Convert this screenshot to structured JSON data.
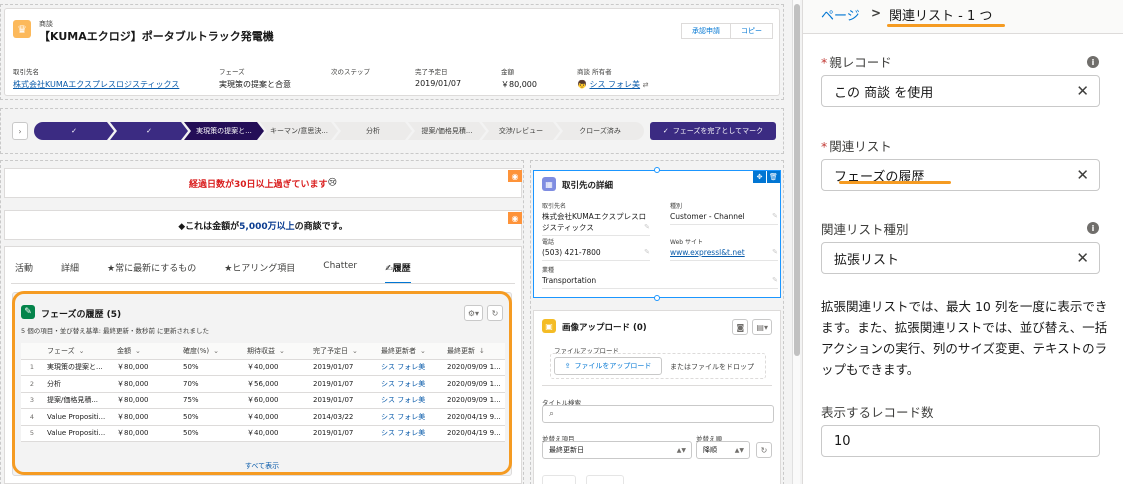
{
  "header": {
    "object_label": "商談",
    "title": "【KUMAエクロジ】ポータブルトラック発電機",
    "buttons": [
      "承認申請",
      "コピー"
    ],
    "fields": [
      {
        "label": "取引先名",
        "value": "株式会社KUMAエクスプレスロジスティックス",
        "link": true
      },
      {
        "label": "フェーズ",
        "value": "実現策の提案と合意",
        "link": false
      },
      {
        "label": "次のステップ",
        "value": "",
        "link": false
      },
      {
        "label": "完了予定日",
        "value": "2019/01/07",
        "link": false
      },
      {
        "label": "金額",
        "value": "￥80,000",
        "link": false
      },
      {
        "label": "商談 所有者",
        "value": "シス フォレ美",
        "link": true
      }
    ]
  },
  "path": {
    "stages": [
      {
        "label": "✓",
        "status": "done"
      },
      {
        "label": "✓",
        "status": "done"
      },
      {
        "label": "実現策の提案と...",
        "status": "current"
      },
      {
        "label": "キーマン/意思決...",
        "status": "todo"
      },
      {
        "label": "分析",
        "status": "todo"
      },
      {
        "label": "提案/価格見積...",
        "status": "todo"
      },
      {
        "label": "交渉/レビュー",
        "status": "todo"
      },
      {
        "label": "クローズ済み",
        "status": "todo"
      }
    ],
    "mark_button": "フェーズを完了としてマーク"
  },
  "banners": {
    "b1_text": "経過日数が30日以上過ぎています",
    "b1_emoji": "😢",
    "b2_prefix": "◆これは金額が",
    "b2_amount": "5,000万以上",
    "b2_suffix": "の商談です。"
  },
  "tabs": [
    "活動",
    "詳細",
    "★常に最新にするもの",
    "★ヒアリング項目",
    "Chatter",
    "✍履歴"
  ],
  "related_list": {
    "title": "フェーズの履歴 (5)",
    "subtitle": "5 個の項目・並び替え基準: 最終更新・数秒前 に更新されました",
    "columns": [
      "",
      "フェーズ",
      "金額",
      "確度(%)",
      "期待収益",
      "完了予定日",
      "最終更新者",
      "最終更新"
    ],
    "rows": [
      [
        "1",
        "実現策の提案と...",
        "￥80,000",
        "50%",
        "￥40,000",
        "2019/01/07",
        "シス フォレ美",
        "2020/09/09 1..."
      ],
      [
        "2",
        "分析",
        "￥80,000",
        "70%",
        "￥56,000",
        "2019/01/07",
        "シス フォレ美",
        "2020/09/09 1..."
      ],
      [
        "3",
        "提案/価格見積...",
        "￥80,000",
        "75%",
        "￥60,000",
        "2019/01/07",
        "シス フォレ美",
        "2020/09/09 1..."
      ],
      [
        "4",
        "Value Propositi...",
        "￥80,000",
        "50%",
        "￥40,000",
        "2014/03/22",
        "シス フォレ美",
        "2020/04/19 9..."
      ],
      [
        "5",
        "Value Propositi...",
        "￥80,000",
        "50%",
        "￥40,000",
        "2019/01/07",
        "シス フォレ美",
        "2020/04/19 9..."
      ]
    ],
    "view_all": "すべて表示"
  },
  "account": {
    "title": "取引先の詳細",
    "name_label": "取引先名",
    "name_value": "株式会社KUMAエクスプレスロジスティックス",
    "type_label": "種別",
    "type_value": "Customer - Channel",
    "phone_label": "電話",
    "phone_value": "(503) 421-7800",
    "web_label": "Web サイト",
    "web_value": "www.expressl&t.net",
    "industry_label": "業種",
    "industry_value": "Transportation"
  },
  "upload": {
    "title": "画像アップロード (0)",
    "file_label": "ファイルアップロード",
    "upload_button": "ファイルをアップロード",
    "drop_text": "またはファイルをドロップ",
    "title_search_label": "タイトル検索",
    "sort_field_label": "並替え項目",
    "sort_field_value": "最終更新日",
    "sort_order_label": "並替え順",
    "sort_order_value": "降順"
  },
  "panel": {
    "breadcrumb_root": "ページ",
    "breadcrumb_sep": ">",
    "breadcrumb_current": "関連リスト - 1 つ",
    "parent_record_label": "親レコード",
    "parent_record_value": "この 商談 を使用",
    "related_list_label": "関連リスト",
    "related_list_value": "フェーズの履歴",
    "related_list_type_label": "関連リスト種別",
    "related_list_type_value": "拡張リスト",
    "help_text": "拡張関連リストでは、最大 10 列を一度に表示できます。また、拡張関連リストでは、並び替え、一括アクションの実行、列のサイズ変更、テキストのラップもできます。",
    "record_count_label": "表示するレコード数",
    "record_count_value": "10"
  },
  "colors": {
    "brand": "#0176d3",
    "path_done": "#3b2b82",
    "highlight": "#f59b22"
  }
}
